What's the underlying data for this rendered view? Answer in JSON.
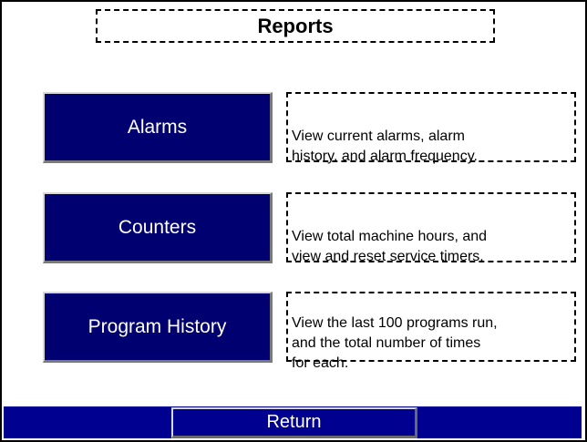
{
  "header": {
    "title": "Reports"
  },
  "menu": {
    "items": [
      {
        "label": "Alarms",
        "description": "View current alarms, alarm\nhistory, and alarm frequency."
      },
      {
        "label": "Counters",
        "description": "View total machine hours, and\nview and reset service timers."
      },
      {
        "label": "Program History",
        "description": "View the last 100 programs run,\nand the total number of times\nfor each."
      }
    ]
  },
  "footer": {
    "return_label": "Return"
  },
  "colors": {
    "button_fill": "#000070",
    "bar_fill": "#000090",
    "text_on_button": "#ffffff"
  }
}
